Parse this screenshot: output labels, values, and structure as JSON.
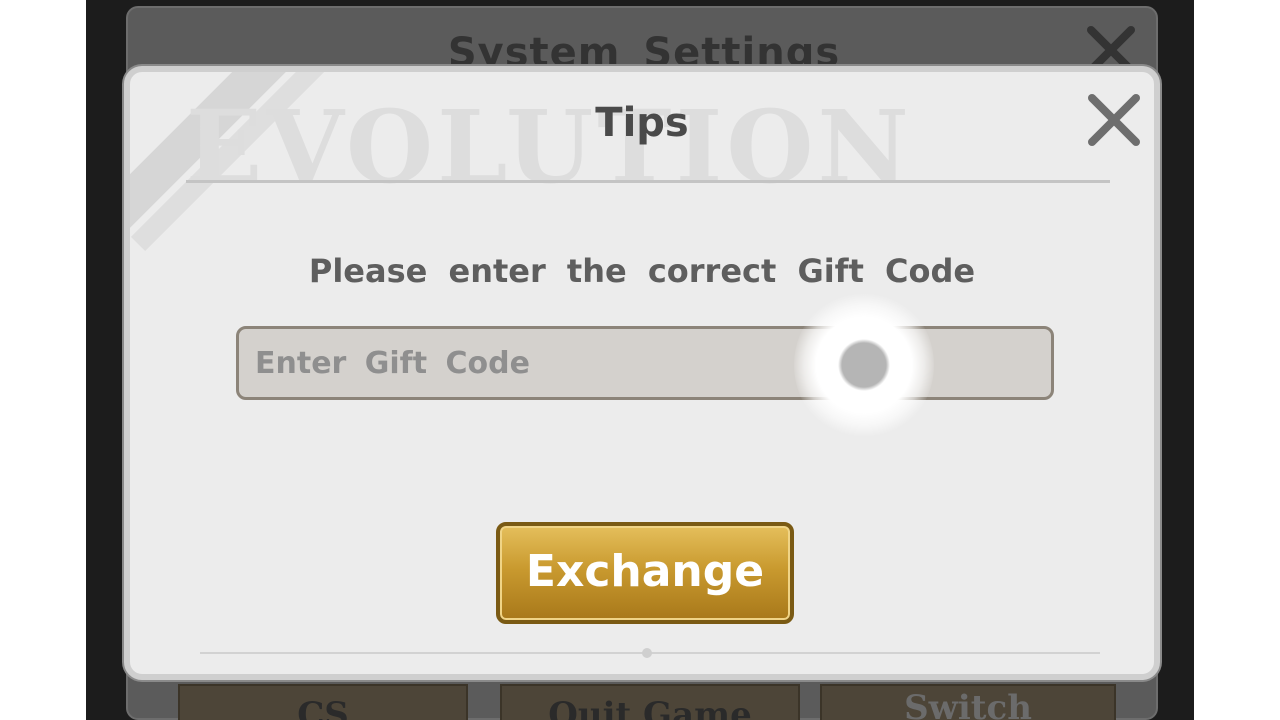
{
  "background_panel": {
    "title": "System Settings",
    "buttons": [
      {
        "label": "CS"
      },
      {
        "label": "Quit Game"
      },
      {
        "label": "Switch"
      }
    ]
  },
  "dialog": {
    "title": "Tips",
    "watermark": "EVOLUTION",
    "prompt": "Please enter the correct Gift Code",
    "input": {
      "value": "",
      "placeholder": "Enter Gift Code"
    },
    "submit_label": "Exchange"
  },
  "icons": {
    "close": "close-icon"
  },
  "colors": {
    "accent_gold": "#c99a2f",
    "dialog_bg": "#ececec",
    "text_gray": "#5e5e5e"
  }
}
